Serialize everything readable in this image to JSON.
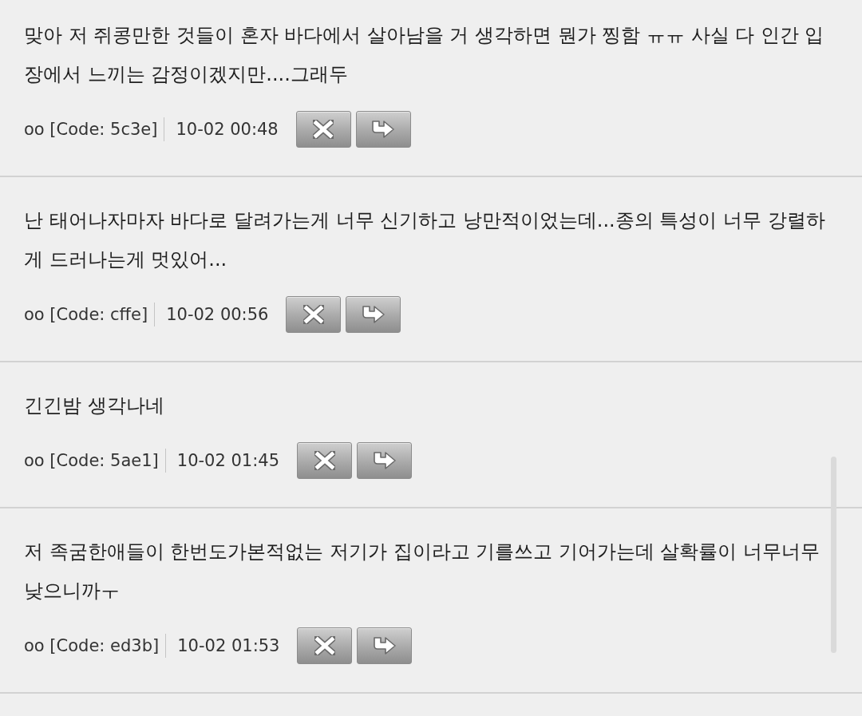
{
  "comments": [
    {
      "text": "맞아 저 쥐콩만한 것들이 혼자 바다에서 살아남을 거 생각하면 뭔가 찡함 ㅠㅠ 사실 다 인간 입장에서 느끼는 감정이겠지만....그래두",
      "author": "oo [Code: 5c3e]",
      "time": "10-02 00:48"
    },
    {
      "text": "난 태어나자마자 바다로 달려가는게 너무 신기하고 낭만적이었는데...종의 특성이 너무 강렬하게 드러나는게 멋있어...",
      "author": "oo [Code: cffe]",
      "time": "10-02 00:56"
    },
    {
      "text": "긴긴밤 생각나네",
      "author": "oo [Code: 5ae1]",
      "time": "10-02 01:45"
    },
    {
      "text": "저 족굼한애들이 한번도가본적없는 저기가 집이라고 기를쓰고 기어가는데 살확률이 너무너무낮으니까ㅜ",
      "author": "oo [Code: ed3b]",
      "time": "10-02 01:53"
    }
  ]
}
